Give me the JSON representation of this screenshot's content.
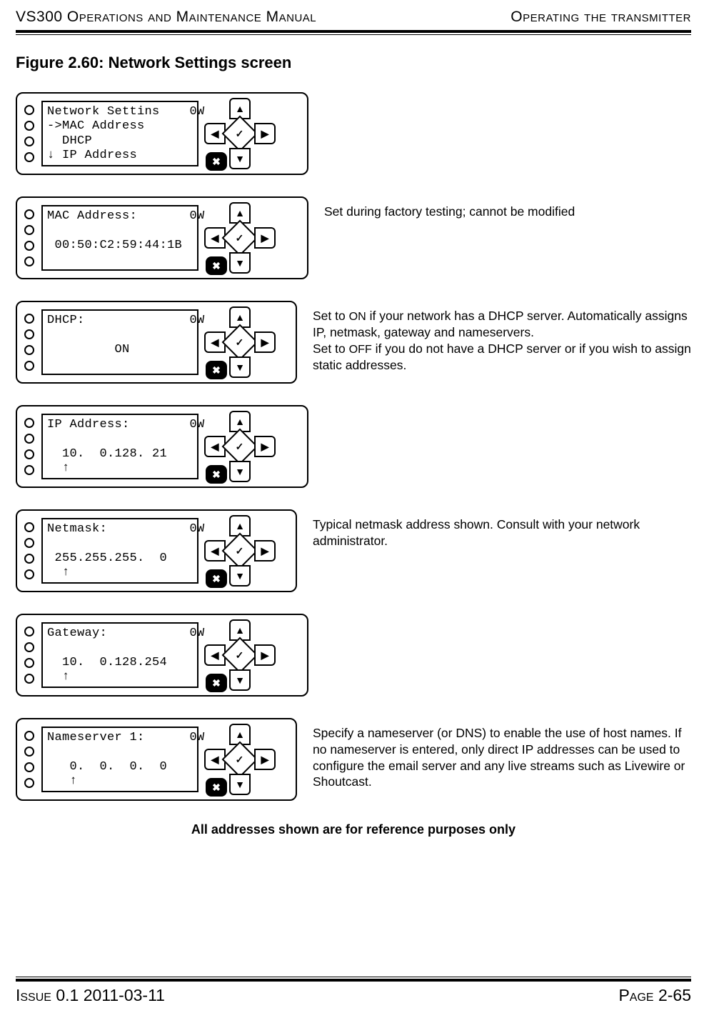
{
  "header": {
    "left": "VS300 Operations and Maintenance Manual",
    "right": "Operating the transmitter"
  },
  "figure_title": "Figure 2.60: Network Settings screen",
  "screens": [
    {
      "lcd": "Network Settins    0W\n->MAC Address\n  DHCP\n↓ IP Address",
      "desc": ""
    },
    {
      "lcd": "MAC Address:       0W\n\n 00:50:C2:59:44:1B",
      "desc": "Set during factory testing; cannot be modified"
    },
    {
      "lcd": "DHCP:              0W\n\n         ON",
      "desc_html": true,
      "desc": "Set to <span class='sc'>ON</span> if your network has a DHCP server. Automatically assigns IP, netmask, gateway and nameservers.<br>Set to <span class='sc'>OFF</span> if you do not have a DHCP server or if you wish to assign static addresses."
    },
    {
      "lcd": "IP Address:        0W\n\n  10.  0.128. 21\n  ↑",
      "desc": ""
    },
    {
      "lcd": "Netmask:           0W\n\n 255.255.255.  0\n  ↑",
      "desc": "Typical netmask address shown. Consult with your network administrator."
    },
    {
      "lcd": "Gateway:           0W\n\n  10.  0.128.254\n  ↑",
      "desc": ""
    },
    {
      "lcd": "Nameserver 1:      0W\n\n   0.  0.  0.  0\n   ↑",
      "desc": "Specify a nameserver (or DNS) to enable the use of host names. If no nameserver is entered, only direct IP addresses can be used to configure the email server and any live streams such as Livewire or Shoutcast."
    }
  ],
  "note": "All addresses shown are for reference purposes only",
  "footer": {
    "left": "Issue 0.1  2011-03-11",
    "right": "Page 2-65"
  }
}
